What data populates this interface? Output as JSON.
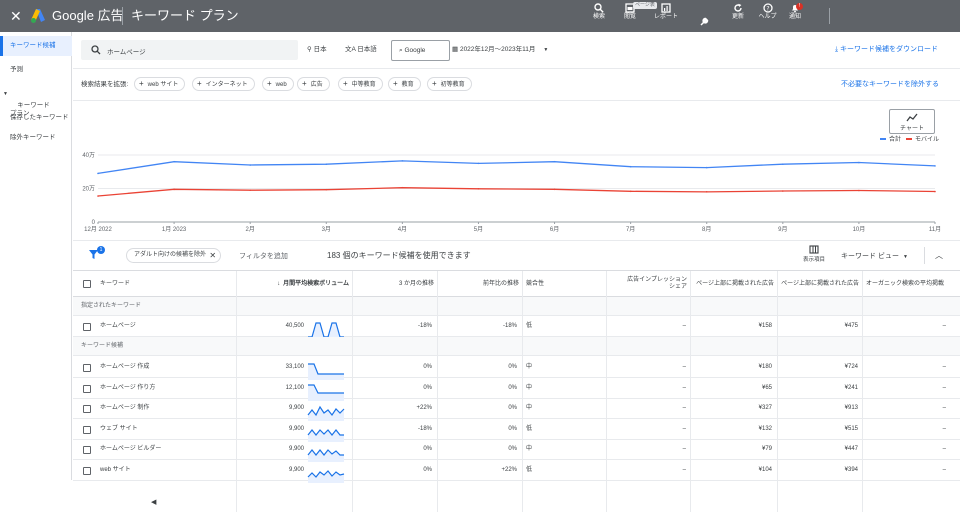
{
  "topbar": {
    "close_icon": "close-icon",
    "brand": "Google 広告",
    "title": "キーワード プラン",
    "nav": [
      {
        "label": "検索",
        "icon": "search-icon"
      },
      {
        "label": "閲覧",
        "icon": "page-icon",
        "badge": "ページ表"
      },
      {
        "label": "レポート",
        "icon": "report-icon"
      },
      {
        "label": "ツールと\n設定",
        "icon": "wrench-icon"
      },
      {
        "label": "更新",
        "icon": "refresh-icon"
      },
      {
        "label": "ヘルプ",
        "icon": "help-icon"
      },
      {
        "label": "通知",
        "icon": "bell-icon",
        "badge": "!"
      }
    ]
  },
  "sidebar": {
    "items": [
      {
        "label": "キーワード候補",
        "active": true
      },
      {
        "label": "予測"
      },
      {
        "label": "キーワード\nプラン"
      },
      {
        "label": "保存したキーワード"
      },
      {
        "label": "除外キーワード"
      }
    ]
  },
  "toolbar": {
    "search_value": "ホームページ",
    "location": "日本",
    "language": "日本語",
    "network": "Google",
    "date_range": "2022年12月～2023年11月",
    "download": "キーワード候補をダウンロード"
  },
  "expand": {
    "label": "検索結果を拡張:",
    "chips": [
      "web サイト",
      "インターネット",
      "web",
      "広告",
      "中等教育",
      "教育",
      "初等教育"
    ],
    "exclude_link": "不必要なキーワードを除外する"
  },
  "chart_panel": {
    "chart_button": "チャート",
    "legend_total": "合計",
    "legend_mobile": "モバイル"
  },
  "chart_data": {
    "type": "line",
    "x": [
      "12月 2022",
      "1月 2023",
      "2月",
      "3月",
      "4月",
      "5月",
      "6月",
      "7月",
      "8月",
      "9月",
      "10月",
      "11月"
    ],
    "yticks": [
      "0",
      "20万",
      "40万"
    ],
    "ylim": [
      0,
      400000
    ],
    "series": [
      {
        "name": "合計",
        "color": "#4285f4",
        "values": [
          290000,
          360000,
          340000,
          345000,
          365000,
          350000,
          360000,
          330000,
          325000,
          345000,
          355000,
          335000
        ]
      },
      {
        "name": "モバイル",
        "color": "#ea4335",
        "values": [
          155000,
          195000,
          190000,
          193000,
          205000,
          198000,
          195000,
          183000,
          180000,
          185000,
          188000,
          182000
        ]
      }
    ]
  },
  "filterbar": {
    "filter_badge": "1",
    "filter_chip": "アダルト向けの候補を除外",
    "add_filter": "フィルタを追加",
    "count_text": "183 個のキーワード候補を使用できます",
    "columns_label": "表示項目",
    "view_label": "キーワード ビュー"
  },
  "table": {
    "headers": [
      "キーワード",
      "月間平均検索ボリューム",
      "3 か月の推移",
      "前年比の推移",
      "競合性",
      "広告インプレッション\nシェア",
      "ページ上部に掲載された広告",
      "ページ上部に掲載された広告",
      "オーガニック検索の平均掲載"
    ],
    "section1": "指定されたキーワード",
    "section2": "キーワード候補",
    "rows": [
      {
        "kw": "ホームページ",
        "vol": "40,500",
        "m3": "-18%",
        "yoy": "-18%",
        "comp": "低",
        "imp": "–",
        "low": "¥158",
        "high": "¥475",
        "org": "–"
      },
      {
        "kw": "ホームページ 作成",
        "vol": "33,100",
        "m3": "0%",
        "yoy": "0%",
        "comp": "中",
        "imp": "–",
        "low": "¥180",
        "high": "¥724",
        "org": "–"
      },
      {
        "kw": "ホームページ 作り方",
        "vol": "12,100",
        "m3": "0%",
        "yoy": "0%",
        "comp": "中",
        "imp": "–",
        "low": "¥65",
        "high": "¥241",
        "org": "–"
      },
      {
        "kw": "ホームページ 制作",
        "vol": "9,900",
        "m3": "+22%",
        "yoy": "0%",
        "comp": "中",
        "imp": "–",
        "low": "¥327",
        "high": "¥913",
        "org": "–"
      },
      {
        "kw": "ウェブ サイト",
        "vol": "9,900",
        "m3": "-18%",
        "yoy": "0%",
        "comp": "低",
        "imp": "–",
        "low": "¥132",
        "high": "¥515",
        "org": "–"
      },
      {
        "kw": "ホームページ ビルダー",
        "vol": "9,900",
        "m3": "0%",
        "yoy": "0%",
        "comp": "中",
        "imp": "–",
        "low": "¥79",
        "high": "¥447",
        "org": "–"
      },
      {
        "kw": "web サイト",
        "vol": "9,900",
        "m3": "0%",
        "yoy": "+22%",
        "comp": "低",
        "imp": "–",
        "low": "¥104",
        "high": "¥394",
        "org": "–"
      }
    ]
  }
}
